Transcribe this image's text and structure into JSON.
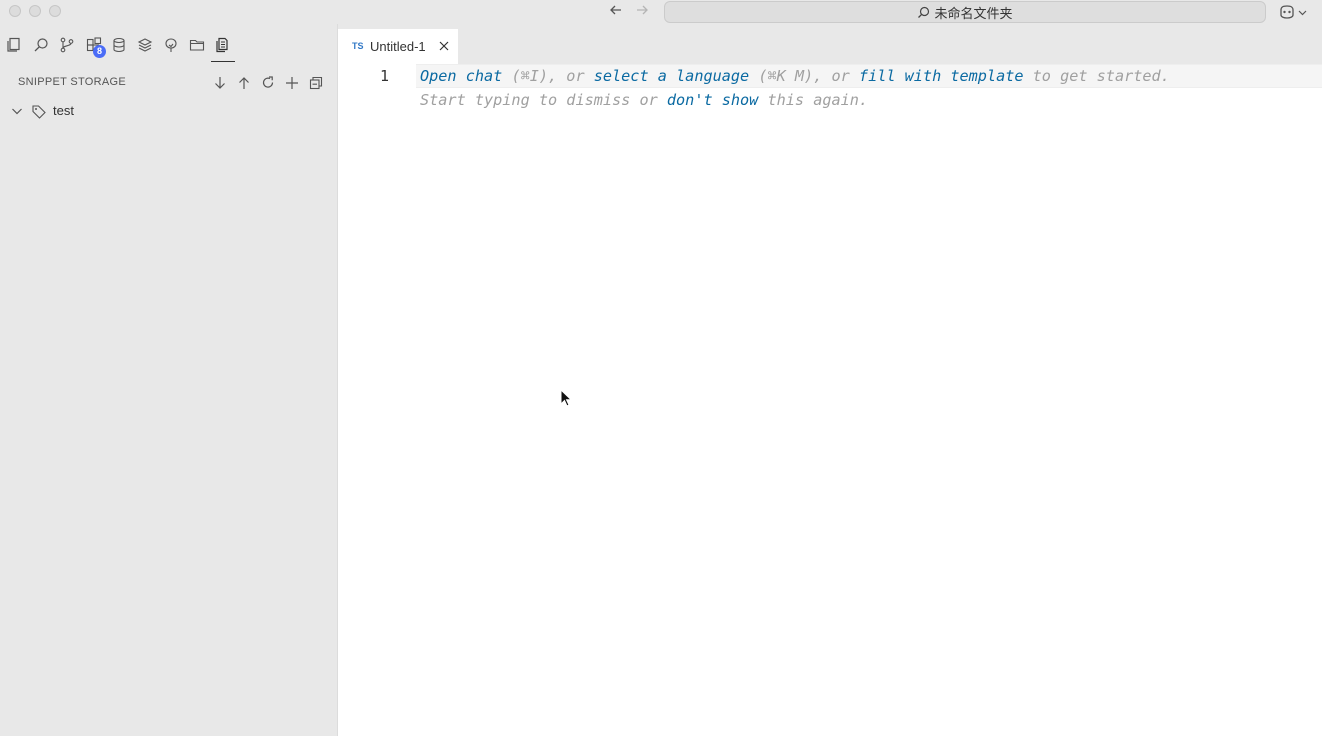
{
  "titlebar": {
    "search_text": "未命名文件夹",
    "back_icon": "arrow-left-icon",
    "forward_icon": "arrow-right-icon"
  },
  "activity_bar": {
    "badge_count": "8",
    "items": [
      "explorer-icon",
      "search-icon",
      "source-control-icon",
      "extensions-icon",
      "database-icon",
      "layers-icon",
      "tree-icon",
      "folder-icon",
      "snippets-icon"
    ]
  },
  "sidebar": {
    "section_title": "SNIPPET STORAGE",
    "tree": [
      {
        "label": "test",
        "icon": "tag-icon",
        "expanded": true
      }
    ]
  },
  "editor": {
    "tab": {
      "lang": "TS",
      "title": "Untitled-1"
    },
    "line_number": "1",
    "hint_line1": {
      "open_chat": "Open chat",
      "open_chat_key": " (⌘I), or ",
      "select_language": "select a language",
      "select_language_key": " (⌘K M), or ",
      "fill_template": "fill with template",
      "tail": " to get started."
    },
    "hint_line2": {
      "start": "Start typing to dismiss or ",
      "dont_show": "don't show",
      "tail": " this again."
    }
  },
  "colors": {
    "accent_link": "#0b6aa2",
    "badge": "#4a6cf7",
    "ts_lang": "#3178c6"
  }
}
